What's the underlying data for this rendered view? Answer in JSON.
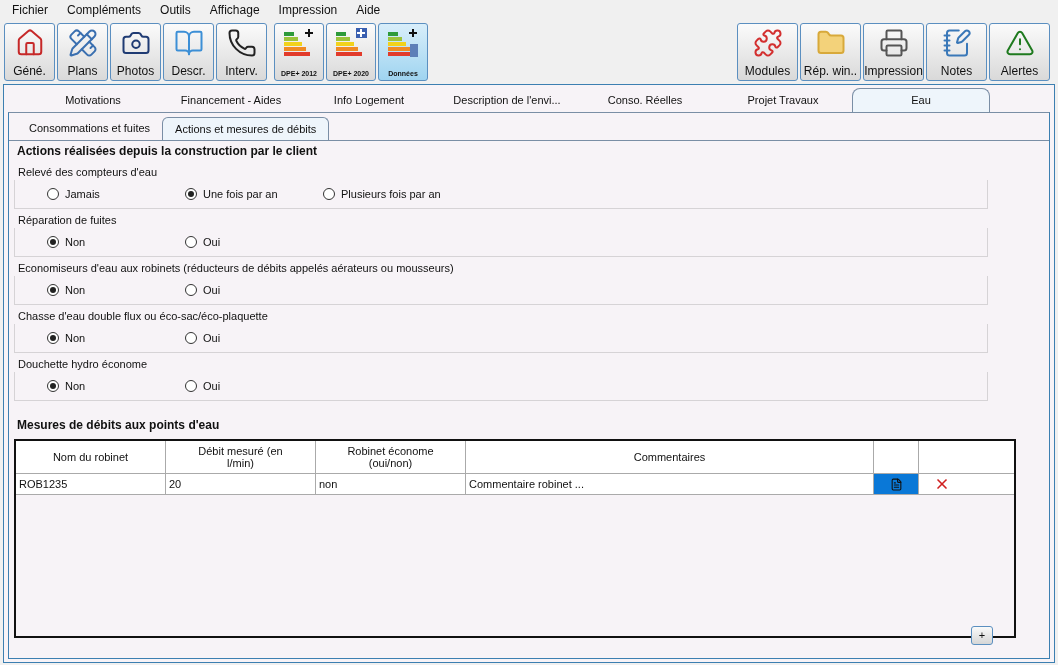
{
  "menu": [
    "Fichier",
    "Compléments",
    "Outils",
    "Affichage",
    "Impression",
    "Aide"
  ],
  "toolbar_left": [
    {
      "label": "Géné.",
      "kind": "home",
      "selected": false
    },
    {
      "label": "Plans",
      "kind": "plans",
      "selected": false
    },
    {
      "label": "Photos",
      "kind": "camera",
      "selected": false
    },
    {
      "label": "Descr.",
      "kind": "notebook",
      "selected": false
    },
    {
      "label": "Interv.",
      "kind": "phone",
      "selected": false
    }
  ],
  "toolbar_dpe": [
    {
      "label": "DPE+ 2012",
      "kind": "dpe",
      "selected": false
    },
    {
      "label": "DPE+ 2020",
      "kind": "dpe2",
      "selected": false
    },
    {
      "label": "Données",
      "kind": "data",
      "selected": true
    }
  ],
  "toolbar_right": [
    {
      "label": "Modules",
      "kind": "puzzle"
    },
    {
      "label": "Rép. win..",
      "kind": "folder"
    },
    {
      "label": "Impression",
      "kind": "printer"
    },
    {
      "label": "Notes",
      "kind": "notes"
    },
    {
      "label": "Alertes",
      "kind": "alert"
    }
  ],
  "tabs": [
    {
      "label": "Motivations",
      "selected": false
    },
    {
      "label": "Financement  - Aides",
      "selected": false
    },
    {
      "label": "Info Logement",
      "selected": false
    },
    {
      "label": "Description de l'envi...",
      "selected": false
    },
    {
      "label": "Conso. Réelles",
      "selected": false
    },
    {
      "label": "Projet Travaux",
      "selected": false
    },
    {
      "label": "Eau",
      "selected": true
    }
  ],
  "subtabs": [
    {
      "label": "Consommations et fuites",
      "selected": false
    },
    {
      "label": "Actions et mesures de débits",
      "selected": true
    }
  ],
  "actions_title": "Actions réalisées depuis la construction par le client",
  "groups": [
    {
      "title": "Relevé des compteurs d'eau",
      "options": [
        {
          "label": "Jamais",
          "selected": false
        },
        {
          "label": "Une fois par an",
          "selected": true
        },
        {
          "label": "Plusieurs fois par an",
          "selected": false
        }
      ]
    },
    {
      "title": "Réparation de fuites",
      "options": [
        {
          "label": "Non",
          "selected": true
        },
        {
          "label": "Oui",
          "selected": false
        }
      ]
    },
    {
      "title": "Economiseurs d'eau aux robinets (réducteurs de débits appelés aérateurs ou mousseurs)",
      "options": [
        {
          "label": "Non",
          "selected": true
        },
        {
          "label": "Oui",
          "selected": false
        }
      ]
    },
    {
      "title": "Chasse d'eau double flux ou éco-sac/éco-plaquette",
      "options": [
        {
          "label": "Non",
          "selected": true
        },
        {
          "label": "Oui",
          "selected": false
        }
      ]
    },
    {
      "title": "Douchette hydro économe",
      "options": [
        {
          "label": "Non",
          "selected": true
        },
        {
          "label": "Oui",
          "selected": false
        }
      ]
    }
  ],
  "measures_title": "Mesures de débits aux points d'eau",
  "table": {
    "columns": [
      "Nom du robinet",
      "Débit mesuré (en l/min)",
      "Robinet économe (oui/non)",
      "Commentaires"
    ],
    "rows": [
      {
        "cells": [
          "ROB1235",
          "20",
          "non",
          "Commentaire robinet ..."
        ]
      }
    ]
  },
  "add_button": "+"
}
